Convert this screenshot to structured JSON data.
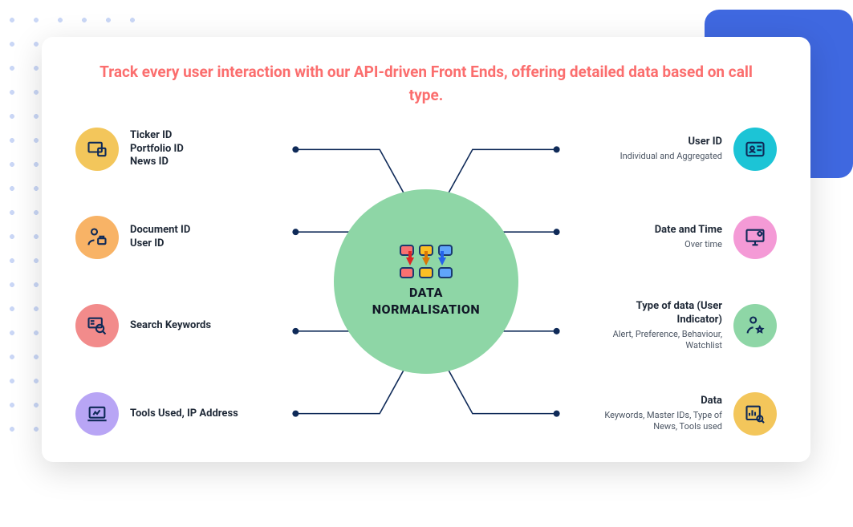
{
  "title": "Track every user interaction with our API-driven Front Ends, offering detailed data based on call type.",
  "center": {
    "line1": "DATA",
    "line2": "NORMALISATION"
  },
  "left": [
    {
      "title": "Ticker ID\nPortfolio ID\nNews ID",
      "sub": "",
      "icon": "devices",
      "color": "c-yellow"
    },
    {
      "title": "Document ID\nUser ID",
      "sub": "",
      "icon": "person-briefcase",
      "color": "c-orange"
    },
    {
      "title": "Search Keywords",
      "sub": "",
      "icon": "search-doc",
      "color": "c-pinkred"
    },
    {
      "title": "Tools Used, IP Address",
      "sub": "",
      "icon": "laptop-chart",
      "color": "c-purple"
    }
  ],
  "right": [
    {
      "title": "User ID",
      "sub": "Individual and Aggregated",
      "icon": "id-card",
      "color": "c-cyan"
    },
    {
      "title": "Date and Time",
      "sub": "Over time",
      "icon": "monitor-gear",
      "color": "c-pink"
    },
    {
      "title": "Type of data (User Indicator)",
      "sub": "Alert, Preference, Behaviour, Watchlist",
      "icon": "person-star",
      "color": "c-green"
    },
    {
      "title": "Data",
      "sub": "Keywords, Master IDs, Type of News, Tools used",
      "icon": "analytics",
      "color": "c-gold"
    }
  ]
}
